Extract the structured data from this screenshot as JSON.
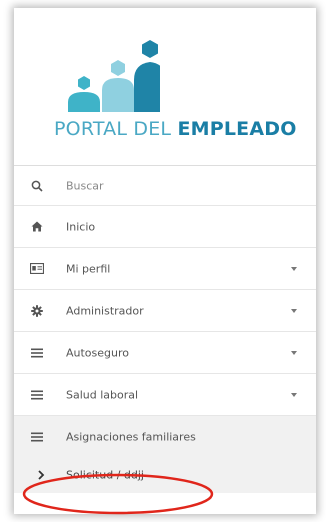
{
  "logo": {
    "text_light": "PORTAL DEL ",
    "text_bold": "EMPLEADO",
    "colors": {
      "light_figure": "#8fd0e0",
      "mid_figure": "#3fb3c8",
      "dark_figure": "#1f84a7"
    }
  },
  "search": {
    "icon": "search-icon",
    "placeholder": "Buscar"
  },
  "menu": {
    "items": [
      {
        "icon": "home-icon",
        "label": "Inicio",
        "has_caret": false
      },
      {
        "icon": "id-card-icon",
        "label": "Mi perfil",
        "has_caret": true
      },
      {
        "icon": "gear-icon",
        "label": "Administrador",
        "has_caret": true
      },
      {
        "icon": "bars-icon",
        "label": "Autoseguro",
        "has_caret": true
      },
      {
        "icon": "bars-icon",
        "label": "Salud laboral",
        "has_caret": true
      },
      {
        "icon": "bars-icon",
        "label": "Asignaciones familiares",
        "has_caret": false
      }
    ],
    "submenu": [
      {
        "icon": "chevron-right-icon",
        "label": "Solicitud / ddjj"
      }
    ]
  },
  "annotation": {
    "color": "#e0261b"
  }
}
